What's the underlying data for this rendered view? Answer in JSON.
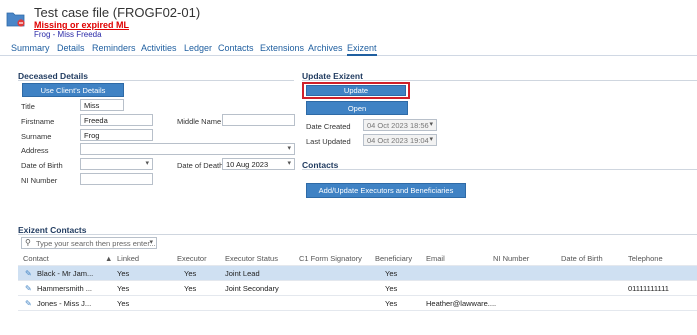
{
  "header": {
    "title": "Test case file (FROGF02-01)",
    "warning": "Missing or expired ML",
    "client": "Frog - Miss Freeda"
  },
  "tabs": [
    "Summary",
    "Details",
    "Reminders",
    "Activities",
    "Ledger",
    "Contacts",
    "Extensions",
    "Archives",
    "Exizent"
  ],
  "active_tab": "Exizent",
  "deceased": {
    "section_title": "Deceased Details",
    "use_client_button": "Use Client's Details",
    "title_label": "Title",
    "title_value": "Miss",
    "firstname_label": "Firstname",
    "firstname_value": "Freeda",
    "middle_name_label": "Middle Name",
    "middle_name_value": "",
    "surname_label": "Surname",
    "surname_value": "Frog",
    "address_label": "Address",
    "address_value": "",
    "dob_label": "Date of Birth",
    "dob_value": "",
    "dod_label": "Date of Death",
    "dod_value": "10 Aug 2023",
    "ni_label": "NI Number",
    "ni_value": ""
  },
  "update_exizent": {
    "section_title": "Update Exizent",
    "update_button": "Update",
    "open_button": "Open",
    "date_created_label": "Date Created",
    "date_created_value": "04 Oct 2023 18:56",
    "last_updated_label": "Last Updated",
    "last_updated_value": "04 Oct 2023 19:04"
  },
  "contacts_section": {
    "section_title": "Contacts",
    "add_button": "Add/Update Executors and Beneficiaries"
  },
  "exizent_contacts": {
    "section_title": "Exizent Contacts",
    "search_placeholder": "Type your search then press enter...",
    "columns": [
      "Contact",
      "Linked",
      "Executor",
      "Executor Status",
      "C1 Form Signatory",
      "Beneficiary",
      "Email",
      "NI Number",
      "Date of Birth",
      "Telephone"
    ],
    "rows": [
      {
        "contact": "Black - Mr Jam...",
        "linked": "Yes",
        "executor": "Yes",
        "executor_status": "Joint Lead",
        "c1": "",
        "beneficiary": "Yes",
        "email": "",
        "ni": "",
        "dob": "",
        "telephone": ""
      },
      {
        "contact": "Hammersmith ...",
        "linked": "Yes",
        "executor": "Yes",
        "executor_status": "Joint Secondary",
        "c1": "",
        "beneficiary": "Yes",
        "email": "",
        "ni": "",
        "dob": "",
        "telephone": "01111111111"
      },
      {
        "contact": "Jones - Miss J...",
        "linked": "Yes",
        "executor": "",
        "executor_status": "",
        "c1": "",
        "beneficiary": "Yes",
        "email": "Heather@lawware....",
        "ni": "",
        "dob": "",
        "telephone": ""
      }
    ]
  },
  "colors": {
    "accent": "#3f82c4",
    "warning": "#e00000",
    "highlight": "#d0202a",
    "selected_row": "#cfe0f2"
  }
}
